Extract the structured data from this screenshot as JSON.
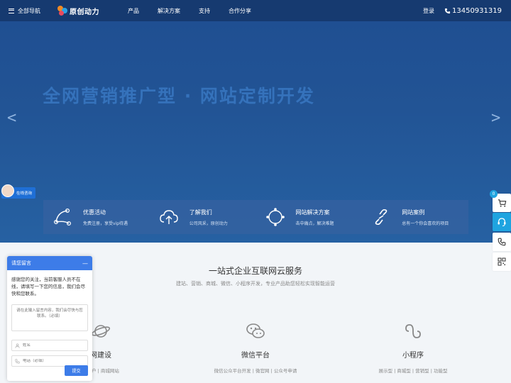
{
  "nav": {
    "all_nav": "全部导航",
    "logo_text": "原创动力",
    "menu": [
      "产品",
      "解决方案",
      "支持",
      "合作分享"
    ],
    "login": "登录",
    "phone": "13450931319"
  },
  "hero": {
    "title": "全网营销推广型 · 网站定制开发",
    "prev": "<",
    "next": ">"
  },
  "chat_tab": {
    "label": "在线咨询"
  },
  "features": [
    {
      "icon": "nodes-icon",
      "title": "优惠活动",
      "sub": "免费注册，享受vip待遇"
    },
    {
      "icon": "cloud-upload-icon",
      "title": "了解我们",
      "sub": "公司风采，原创动力"
    },
    {
      "icon": "compass-icon",
      "title": "网站解决方案",
      "sub": "击中痛点，解决难题"
    },
    {
      "icon": "link-icon",
      "title": "网站案例",
      "sub": "总有一个你会喜欢的项目"
    }
  ],
  "section": {
    "title": "一站式企业互联网云服务",
    "subtitle": "建站、营销、商城、微信、小程序开发，专业产品助您轻松实现智能运营"
  },
  "services": [
    {
      "icon": "planet-icon",
      "title": "网建设",
      "sub": "动门户 | 商城网站"
    },
    {
      "icon": "wechat-icon",
      "title": "微信平台",
      "sub": "微信公众平台开发 | 微官网 | 公众号申请"
    },
    {
      "icon": "mini-program-icon",
      "title": "小程序",
      "sub": "展示型 | 商城型 | 营销型 | 功能型"
    }
  ],
  "sidebar": {
    "cart_badge": "0"
  },
  "message_box": {
    "title": "请您留言",
    "minimize": "—",
    "intro": "感谢您的关注，当前客服人员不在线，请填写一下您的信息，我们会尽快和您联系。",
    "content_placeholder": "请在此输入留言内容，我们会尽快与您联系。（必填）",
    "name_placeholder": "姓名",
    "phone_placeholder": "电话（必填）",
    "submit": "提交"
  },
  "colors": {
    "nav_bg": "#163a70",
    "accent": "#1fa4e0",
    "message_head": "#3d7ce8"
  }
}
